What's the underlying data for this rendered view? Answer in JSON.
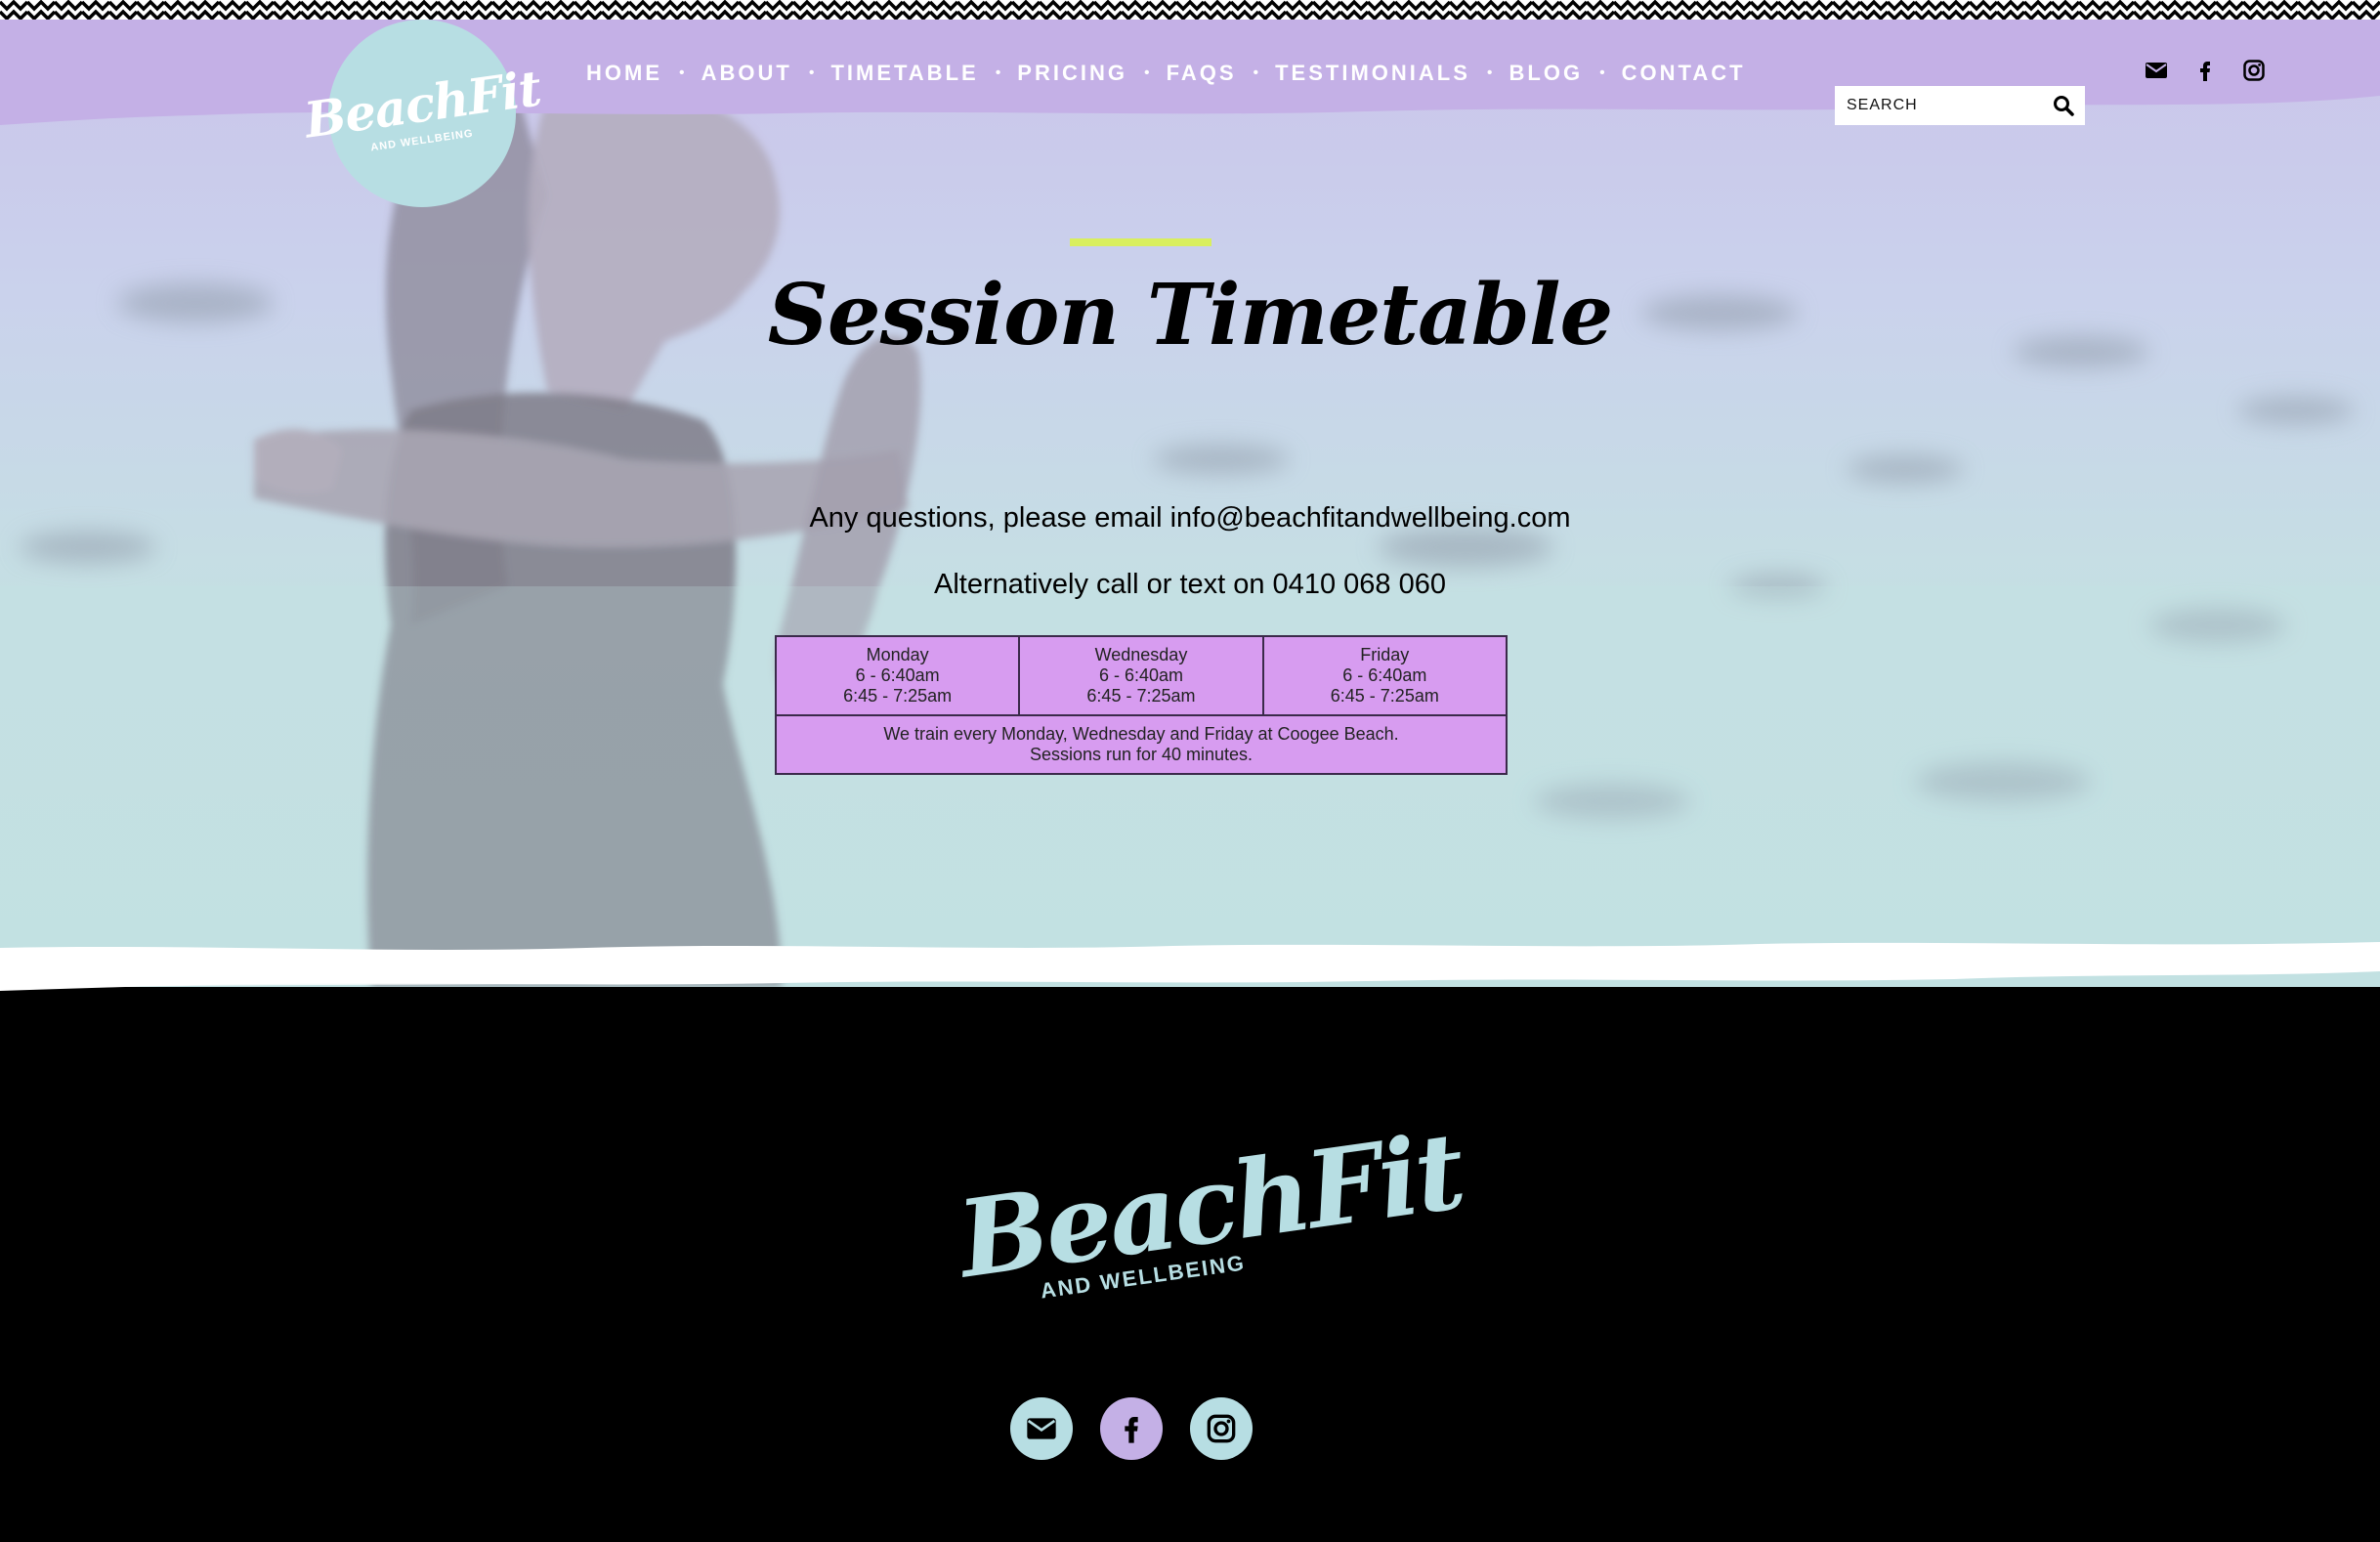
{
  "brand": {
    "logo_script": "BeachFit",
    "logo_sub": "AND WELLBEING"
  },
  "nav": {
    "items": [
      {
        "label": "HOME"
      },
      {
        "label": "ABOUT"
      },
      {
        "label": "TIMETABLE"
      },
      {
        "label": "PRICING"
      },
      {
        "label": "FAQS"
      },
      {
        "label": "TESTIMONIALS"
      },
      {
        "label": "BLOG"
      },
      {
        "label": "CONTACT"
      }
    ],
    "separator": "•"
  },
  "search": {
    "placeholder": "SEARCH",
    "icon": "search-icon"
  },
  "social": {
    "icons": [
      "envelope-icon",
      "facebook-icon",
      "instagram-icon"
    ]
  },
  "hero": {
    "title": "Session Timetable",
    "line1": "Any questions, please email info@beachfitandwellbeing.com",
    "line2": "Alternatively call or text on 0410 068 060"
  },
  "timetable": {
    "days": [
      {
        "day": "Monday",
        "slot1": "6 - 6:40am",
        "slot2": "6:45 - 7:25am"
      },
      {
        "day": "Wednesday",
        "slot1": "6 - 6:40am",
        "slot2": "6:45 - 7:25am"
      },
      {
        "day": "Friday",
        "slot1": "6 - 6:40am",
        "slot2": "6:45 - 7:25am"
      }
    ],
    "note_line1": "We train every Monday, Wednesday and Friday at Coogee Beach.",
    "note_line2": "Sessions run for 40 minutes."
  },
  "colors": {
    "lavender": "#c4b0e6",
    "aqua": "#b7dee3",
    "accent": "#d9ef5e",
    "table_bg": "#d79cf0",
    "footer_bg": "#000000"
  }
}
